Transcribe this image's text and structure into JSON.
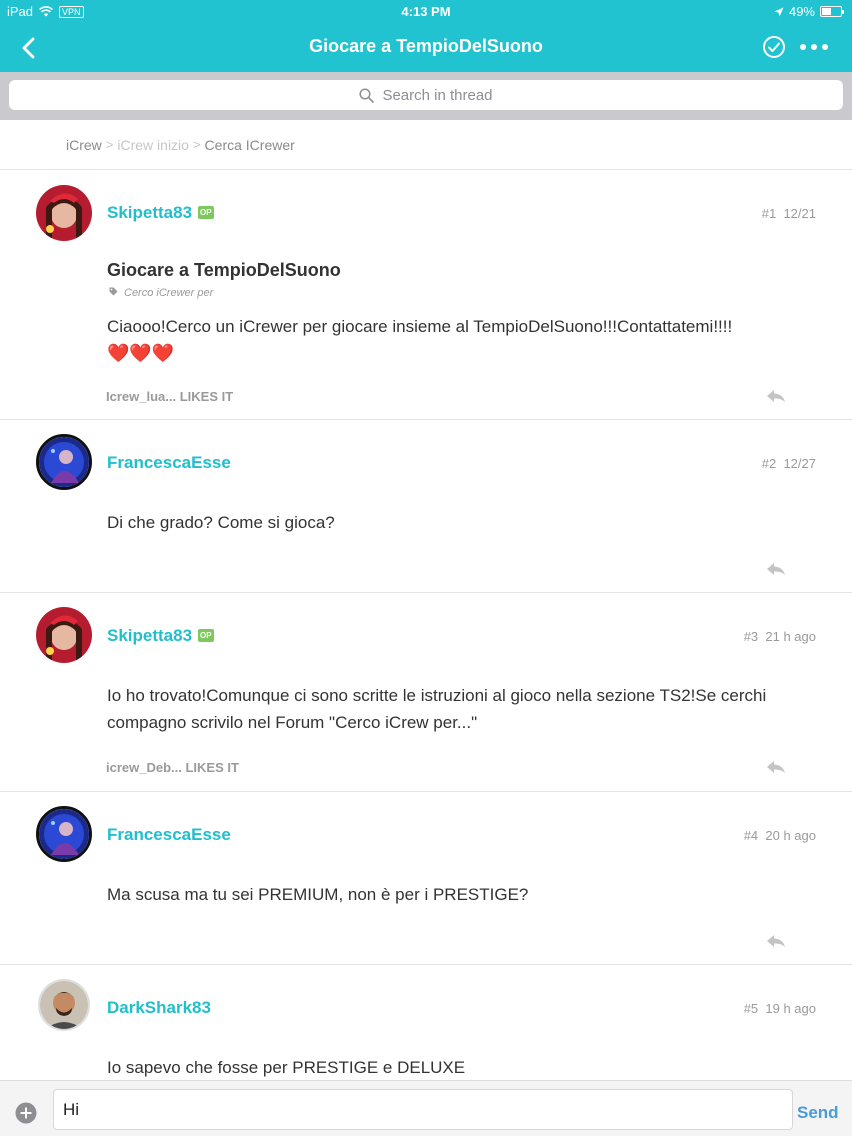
{
  "status_bar": {
    "device": "iPad",
    "vpn": "VPN",
    "time": "4:13 PM",
    "battery": "49%",
    "battery_level": 0.49
  },
  "nav": {
    "title": "Giocare a TempioDelSuono",
    "back_icon": "chevron-left-icon",
    "done_icon": "check-circle-icon",
    "more_icon": "more-dots-icon"
  },
  "search": {
    "placeholder": "Search in thread"
  },
  "breadcrumb": {
    "items": [
      "iCrew",
      "iCrew inizio",
      "Cerca ICrewer"
    ],
    "separator": ">"
  },
  "posts": [
    {
      "author": "Skipetta83",
      "op_badge": "OP",
      "number": "#1",
      "date": "12/21",
      "title": "Giocare a TempioDelSuono",
      "tag": "Cerco iCrewer per",
      "body": "Ciaooo!Cerco un iCrewer per giocare insieme al TempioDelSuono!!!Contattatemi!!!!",
      "hearts": "❤️❤️❤️",
      "likes": "Icrew_lua... LIKES IT"
    },
    {
      "author": "FrancescaEsse",
      "number": "#2",
      "date": "12/27",
      "body": "Di che grado? Come si gioca?"
    },
    {
      "author": "Skipetta83",
      "op_badge": "OP",
      "number": "#3",
      "date": "21 h ago",
      "body": "Io ho trovato!Comunque ci sono scritte le istruzioni al gioco nella sezione TS2!Se cerchi compagno scrivilo nel Forum \"Cerco iCrew per...\"",
      "likes": "icrew_Deb... LIKES IT"
    },
    {
      "author": "FrancescaEsse",
      "number": "#4",
      "date": "20 h ago",
      "body": "Ma scusa ma tu sei PREMIUM, non è per i PRESTIGE?"
    },
    {
      "author": "DarkShark83",
      "number": "#5",
      "date": "19 h ago",
      "body": "Io sapevo che fosse per PRESTIGE e DELUXE"
    }
  ],
  "composer": {
    "value": "Hi",
    "send": "Send",
    "add_icon": "plus-circle-icon"
  },
  "colors": {
    "accent": "#20c3cf",
    "username": "#20bfcb",
    "op_badge": "#7dc95e",
    "send": "#4a9bd8"
  }
}
